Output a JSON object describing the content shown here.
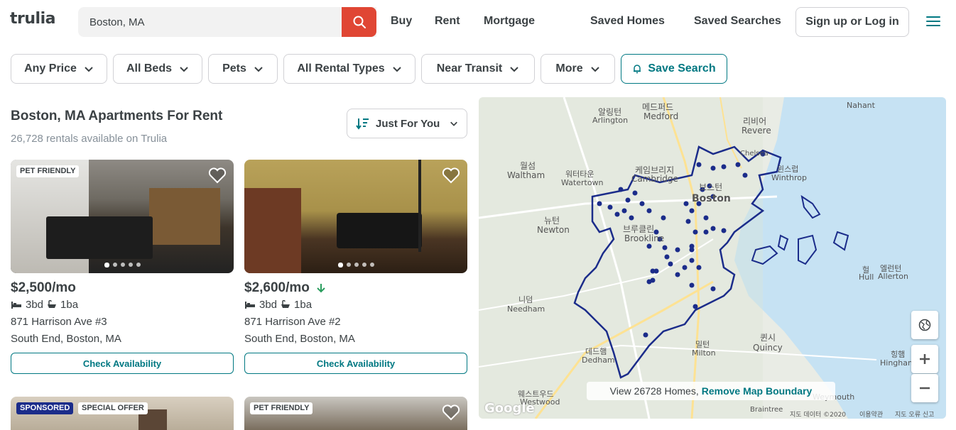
{
  "header": {
    "logo": "trulia",
    "search_value": "Boston, MA",
    "nav": [
      "Buy",
      "Rent",
      "Mortgage",
      "Saved Homes",
      "Saved Searches"
    ],
    "login_label": "Sign up or Log in"
  },
  "filters": [
    "Any Price",
    "All Beds",
    "Pets",
    "All Rental Types",
    "Near Transit",
    "More"
  ],
  "save_search_label": "Save Search",
  "results": {
    "title": "Boston, MA Apartments For Rent",
    "count_text": "26,728 rentals available on Trulia",
    "sort_label": "Just For You"
  },
  "listings": [
    {
      "badge": "PET FRIENDLY",
      "price": "$2,500/mo",
      "beds": "3bd",
      "baths": "1ba",
      "address": "871 Harrison Ave #3",
      "neighborhood": "South End, Boston, MA",
      "cta": "Check Availability"
    },
    {
      "badge": "",
      "price": "$2,600/mo",
      "beds": "3bd",
      "baths": "1ba",
      "address": "871 Harrison Ave #2",
      "neighborhood": "South End, Boston, MA",
      "cta": "Check Availability"
    },
    {
      "badges": [
        "SPONSORED",
        "SPECIAL OFFER"
      ]
    },
    {
      "badge": "PET FRIENDLY"
    }
  ],
  "map": {
    "labels": [
      "메드퍼드",
      "Medford",
      "알링턴",
      "Arlington",
      "리비어",
      "Revere",
      "월섬",
      "Waltham",
      "워터타운",
      "Watertown",
      "케임브리지",
      "Cambridge",
      "보스턴",
      "Boston",
      "윈스럽",
      "Winthrop",
      "뉴턴",
      "Newton",
      "브루클린",
      "Brookline",
      "니덤",
      "Needham",
      "데드햄",
      "Dedham",
      "밀턴",
      "Milton",
      "퀸시",
      "Quincy",
      "힝햄",
      "Hingham",
      "헐",
      "Hull",
      "엘런턴",
      "Allerton",
      "웨스트우드",
      "Westwood",
      "Nahant",
      "Chelsea",
      "Braintree",
      "Weymouth"
    ],
    "banner_prefix": "View 26728 Homes,",
    "banner_link": "Remove Map Boundary",
    "footer": [
      "지도 데이터 ©2020",
      "이용약관",
      "지도 오류 신고"
    ],
    "google": "Google"
  },
  "colors": {
    "accent": "#007882",
    "search": "#e04634",
    "boundary": "#1b2c8a",
    "sponsored": "#1b2c8a"
  }
}
